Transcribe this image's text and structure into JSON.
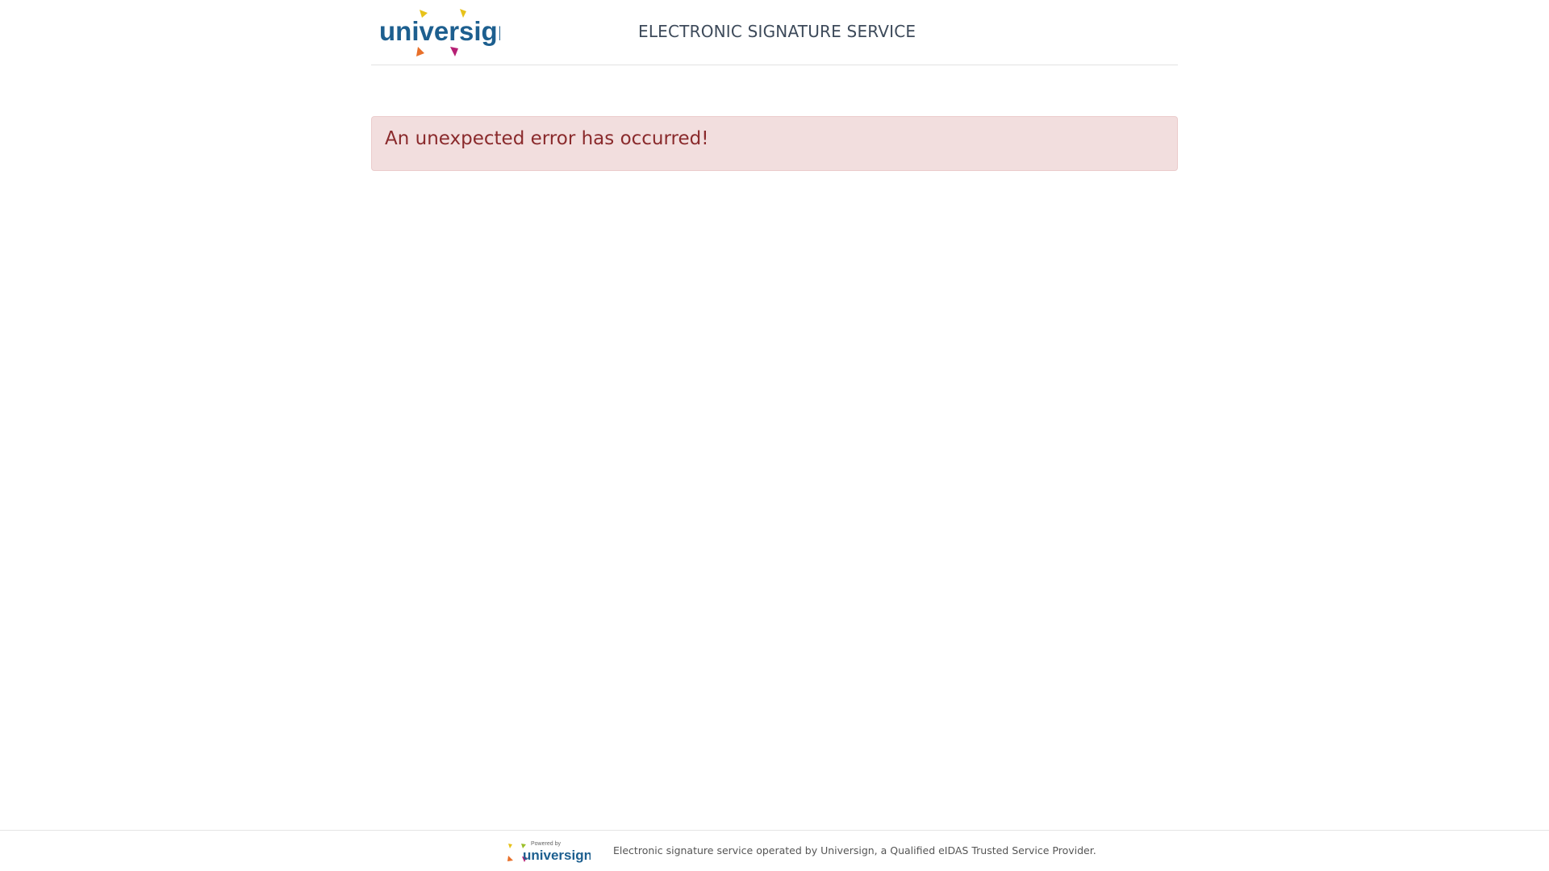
{
  "header": {
    "logo_text": "universign",
    "title": "ELECTRONIC SIGNATURE SERVICE"
  },
  "alert": {
    "message": "An unexpected error has occurred!"
  },
  "footer": {
    "logo_powered_by": "Powered by",
    "logo_text": "universign",
    "description": "Electronic signature service operated by Universign, a Qualified eIDAS Trusted Service Provider."
  },
  "colors": {
    "brand_blue": "#1d5f8f",
    "arrow_yellow": "#e7c21a",
    "arrow_orange": "#e8702a",
    "arrow_magenta": "#b61f74",
    "arrow_green": "#9bbf2a",
    "alert_bg": "#f2dede",
    "alert_text": "#8a2a2c"
  }
}
